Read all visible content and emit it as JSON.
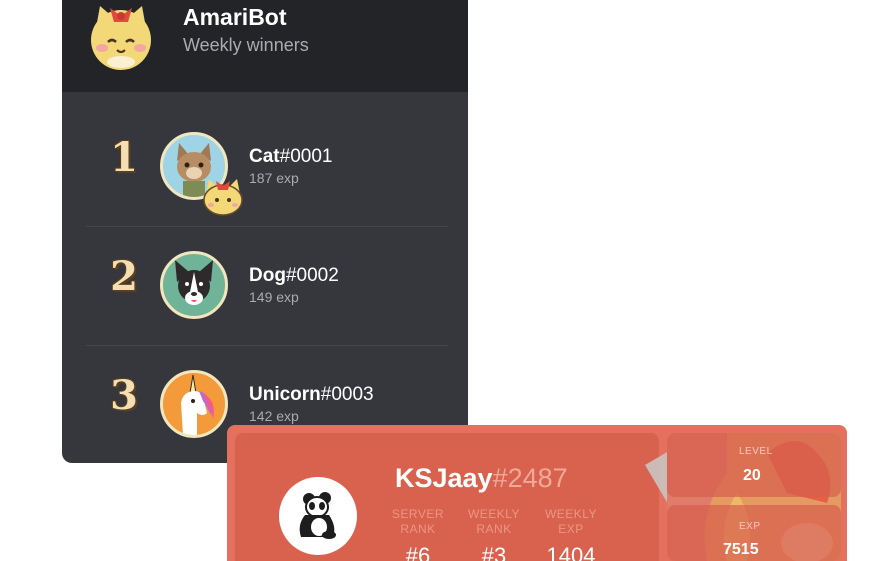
{
  "leaderboard": {
    "bot_name": "AmariBot",
    "subtitle": "Weekly winners",
    "entries": [
      {
        "rank": "1",
        "name": "Cat",
        "tag": "#0001",
        "exp": "187 exp"
      },
      {
        "rank": "2",
        "name": "Dog",
        "tag": "#0002",
        "exp": "149 exp"
      },
      {
        "rank": "3",
        "name": "Unicorn",
        "tag": "#0003",
        "exp": "142 exp"
      }
    ]
  },
  "rank_card": {
    "username": "KSJaay",
    "tag": "#2487",
    "stats": [
      {
        "label_line1": "SERVER",
        "label_line2": "RANK",
        "value": "#6"
      },
      {
        "label_line1": "WEEKLY",
        "label_line2": "RANK",
        "value": "#3"
      },
      {
        "label_line1": "WEEKLY",
        "label_line2": "EXP",
        "value": "1404"
      }
    ],
    "level_label": "LEVEL",
    "level_value": "20",
    "exp_label": "EXP",
    "exp_value": "7515"
  },
  "colors": {
    "panel_bg": "#36373c",
    "header_bg": "#232428",
    "card_bg": "#e4715d",
    "rank_gold": "#f4dfb2"
  },
  "icons": {
    "bot_avatar": "cat-mascot-icon",
    "cat_avatar": "cat-avatar-icon",
    "dog_avatar": "dog-avatar-icon",
    "unicorn_avatar": "unicorn-avatar-icon",
    "panda_avatar": "panda-avatar-icon"
  }
}
